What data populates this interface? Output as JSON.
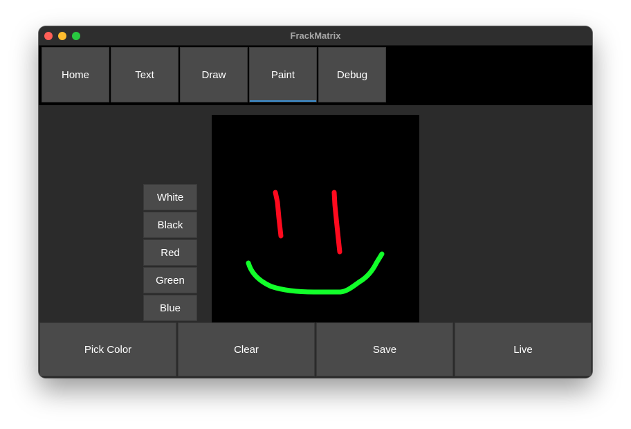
{
  "window": {
    "title": "FrackMatrix"
  },
  "tabs": [
    {
      "label": "Home",
      "active": false
    },
    {
      "label": "Text",
      "active": false
    },
    {
      "label": "Draw",
      "active": false
    },
    {
      "label": "Paint",
      "active": true
    },
    {
      "label": "Debug",
      "active": false
    }
  ],
  "colors": [
    {
      "label": "White",
      "value": "#ffffff"
    },
    {
      "label": "Black",
      "value": "#000000"
    },
    {
      "label": "Red",
      "value": "#ff0000"
    },
    {
      "label": "Green",
      "value": "#00ff00"
    },
    {
      "label": "Blue",
      "value": "#0000ff"
    }
  ],
  "canvas": {
    "background": "#000000",
    "strokes": [
      {
        "name": "left-eye",
        "color": "#ff0a1e"
      },
      {
        "name": "right-eye",
        "color": "#ff0a1e"
      },
      {
        "name": "smile",
        "color": "#12ff2a"
      }
    ]
  },
  "actions": [
    {
      "label": "Pick Color"
    },
    {
      "label": "Clear"
    },
    {
      "label": "Save"
    },
    {
      "label": "Live"
    }
  ],
  "theme": {
    "accent": "#3d8fd1",
    "button_bg": "#4a4a4a",
    "window_bg": "#2b2b2b"
  }
}
